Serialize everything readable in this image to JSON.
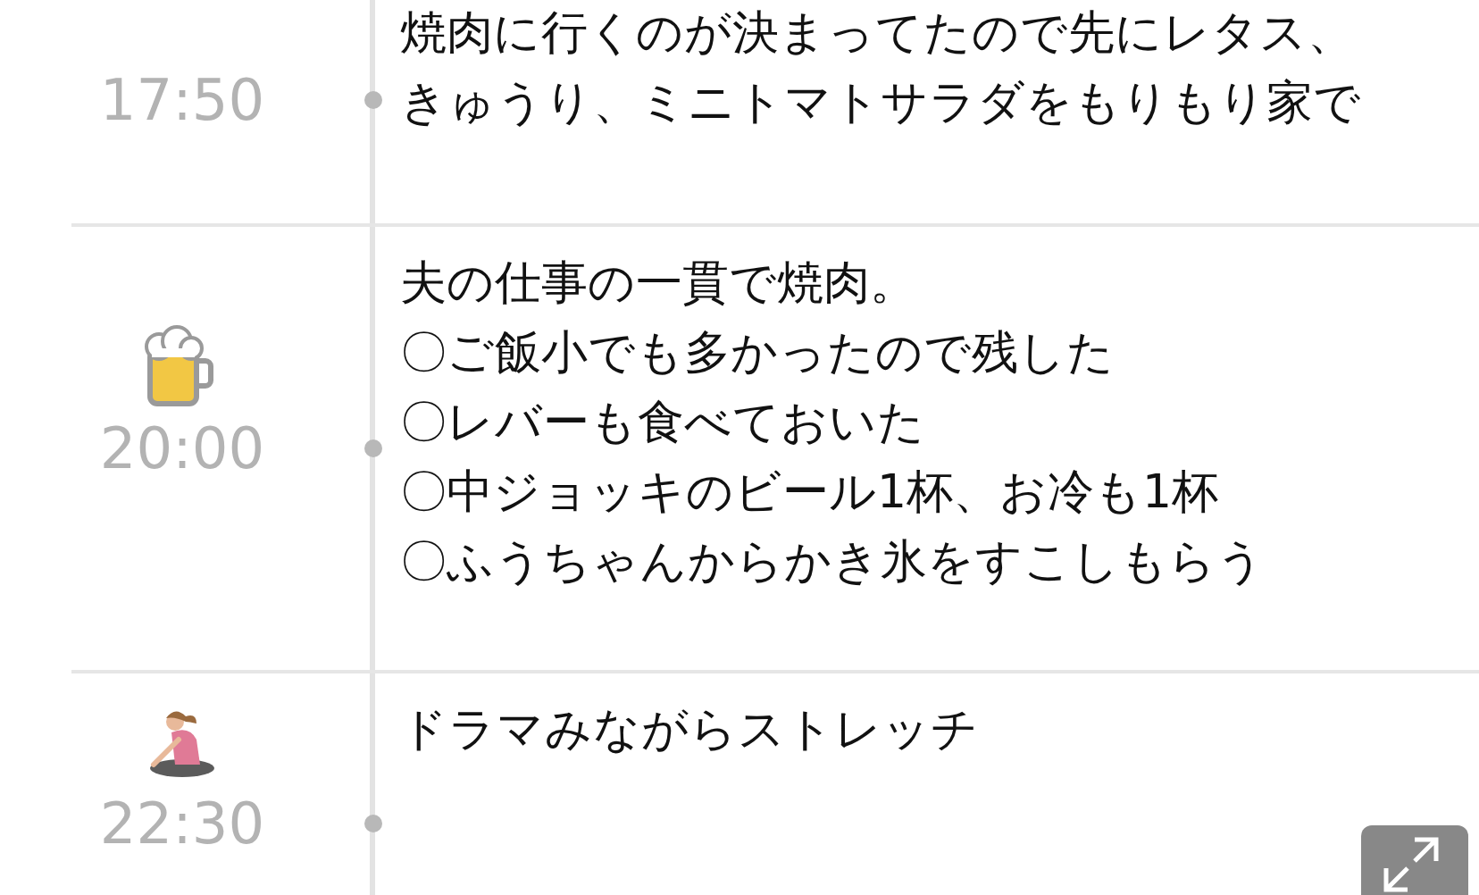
{
  "entries": [
    {
      "time": "17:50",
      "lines": [
        "焼肉に行くのが決まってたので先にレタス、",
        "きゅうり、ミニトマトサラダをもりもり家で"
      ]
    },
    {
      "time": "20:00",
      "kind": "beer",
      "lines": [
        "夫の仕事の一貫で焼肉。",
        "〇ご飯小でも多かったので残した",
        "〇レバーも食べておいた",
        "〇中ジョッキのビール1杯、お冷も1杯",
        "〇ふうちゃんからかき氷をすこしもらう"
      ]
    },
    {
      "time": "22:30",
      "kind": "stretch",
      "lines": [
        "ドラマみながらストレッチ"
      ]
    }
  ]
}
